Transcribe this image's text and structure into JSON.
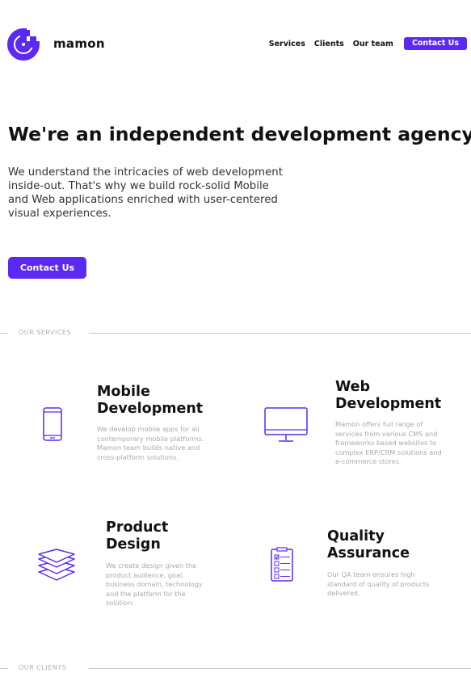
{
  "header": {
    "logo_text": "mamon",
    "nav": [
      "Services",
      "Clients",
      "Our team"
    ],
    "cta": "Contact Us",
    "brand_color": "#5a2af4"
  },
  "hero": {
    "title": "We're an independent development agency.",
    "description": "We understand the intricacies of web development inside-out. That's why we build rock-solid Mobile and Web applications enriched with user-centered visual experiences.",
    "cta": "Contact Us"
  },
  "services_section": {
    "label": "OUR SERVICES",
    "items": [
      {
        "icon": "smartphone-icon",
        "title_line1": "Mobile",
        "title_line2": "Development",
        "description": "We develop mobile apps for all contemporary mobile platforms. Mamon team builds native and cross-platform solutions."
      },
      {
        "icon": "monitor-icon",
        "title_line1": "Web",
        "title_line2": "Development",
        "description": "Mamon offers full range of services from various CMS and frameworks based websites to complex ERP/CRM solutions and e-commerce stores."
      },
      {
        "icon": "layers-icon",
        "title_line1": "Product",
        "title_line2": "Design",
        "description": "We create design given the product audience, goal, business domain, technology and the platform for the solution."
      },
      {
        "icon": "checklist-icon",
        "title_line1": "Quality",
        "title_line2": "Assurance",
        "description": "Our QA team ensures high standard of quality of products delivered."
      }
    ]
  },
  "clients_section": {
    "label": "OUR CLIENTS"
  }
}
